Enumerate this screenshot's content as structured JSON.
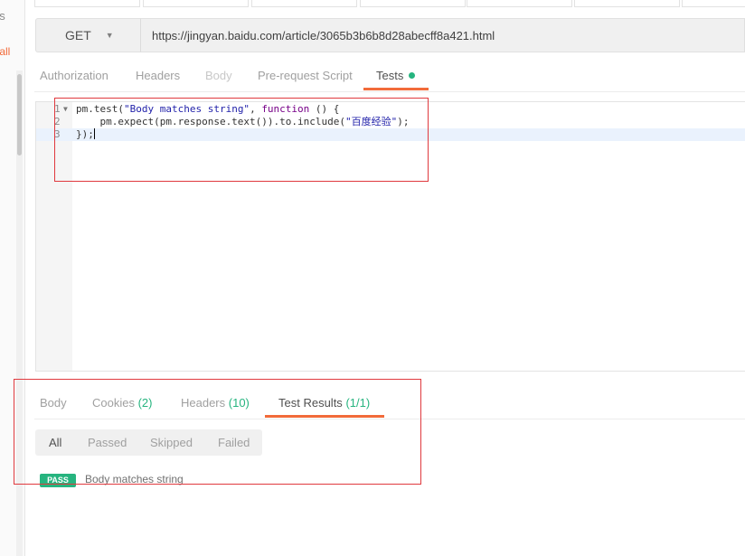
{
  "sidebar": {
    "partial_text_1": "ns",
    "partial_link": "r all"
  },
  "request": {
    "method": "GET",
    "url": "https://jingyan.baidu.com/article/3065b3b6b8d28abecff8a421.html"
  },
  "request_tabs": [
    {
      "label": "Authorization"
    },
    {
      "label": "Headers"
    },
    {
      "label": "Body"
    },
    {
      "label": "Pre-request Script"
    },
    {
      "label": "Tests"
    }
  ],
  "editor": {
    "lines": [
      {
        "num": "1",
        "code": "pm.test(\"Body matches string\", function () {"
      },
      {
        "num": "2",
        "code": "    pm.expect(pm.response.text()).to.include(\"百度经验\");"
      },
      {
        "num": "3",
        "code": "});"
      }
    ]
  },
  "response_tabs": [
    {
      "label": "Body",
      "count": ""
    },
    {
      "label": "Cookies",
      "count": "(2)"
    },
    {
      "label": "Headers",
      "count": "(10)"
    },
    {
      "label": "Test Results",
      "count": "(1/1)"
    }
  ],
  "filters": [
    "All",
    "Passed",
    "Skipped",
    "Failed"
  ],
  "result": {
    "badge": "PASS",
    "name": "Body matches string"
  },
  "colors": {
    "accent": "#f26b3a",
    "success": "#26b47f",
    "annotation": "#e0393e"
  }
}
